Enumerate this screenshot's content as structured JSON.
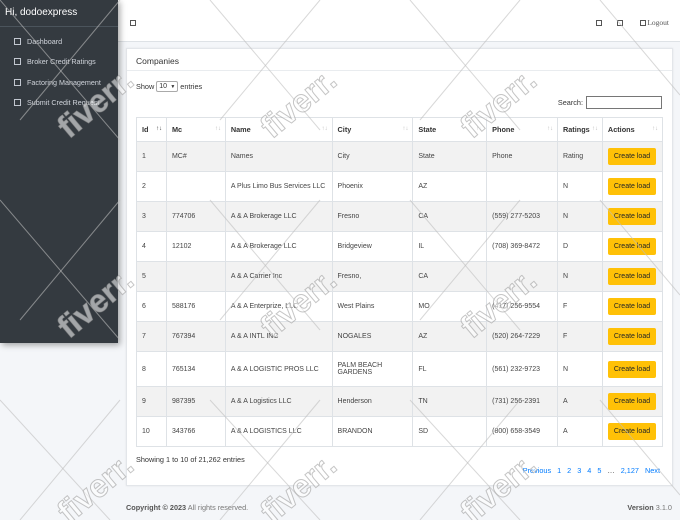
{
  "sidebar": {
    "greeting": "Hi, dodoexpress",
    "items": [
      {
        "label": "Dashboard"
      },
      {
        "label": "Broker Credit Ratings"
      },
      {
        "label": "Factoring Management"
      },
      {
        "label": "Submit Credit Request"
      }
    ]
  },
  "topbar": {
    "logout": "Logout"
  },
  "card": {
    "title": "Companies",
    "show_label": "Show",
    "entries_value": "10",
    "entries_label": "entries",
    "search_label": "Search:"
  },
  "table": {
    "columns": [
      "Id",
      "Mc",
      "Name",
      "City",
      "State",
      "Phone",
      "Ratings",
      "Actions"
    ],
    "rows": [
      {
        "id": "1",
        "mc": "MC#",
        "name": "Names",
        "city": "City",
        "state": "State",
        "phone": "Phone",
        "rating": "Rating",
        "action": "Create load"
      },
      {
        "id": "2",
        "mc": "",
        "name": "A Plus Limo Bus Services LLC",
        "city": "Phoenix",
        "state": "AZ",
        "phone": "",
        "rating": "N",
        "action": "Create load"
      },
      {
        "id": "3",
        "mc": "774706",
        "name": "A & A Brokerage LLC",
        "city": "Fresno",
        "state": "CA",
        "phone": "(559) 277-5203",
        "rating": "N",
        "action": "Create load"
      },
      {
        "id": "4",
        "mc": "12102",
        "name": "A & A Brokerage LLC",
        "city": "Bridgeview",
        "state": "IL",
        "phone": "(708) 369-8472",
        "rating": "D",
        "action": "Create load"
      },
      {
        "id": "5",
        "mc": "",
        "name": "A & A Carrier Inc",
        "city": "Fresno,",
        "state": "CA",
        "phone": "",
        "rating": "N",
        "action": "Create load"
      },
      {
        "id": "6",
        "mc": "588176",
        "name": "A & A Enterprize, LLC",
        "city": "West Plains",
        "state": "MO",
        "phone": "(417) 256-9554",
        "rating": "F",
        "action": "Create load"
      },
      {
        "id": "7",
        "mc": "767394",
        "name": "A & A INTL INC",
        "city": "NOGALES",
        "state": "AZ",
        "phone": "(520) 264-7229",
        "rating": "F",
        "action": "Create load"
      },
      {
        "id": "8",
        "mc": "765134",
        "name": "A & A LOGISTIC PROS LLC",
        "city": "PALM BEACH GARDENS",
        "state": "FL",
        "phone": "(561) 232-9723",
        "rating": "N",
        "action": "Create load"
      },
      {
        "id": "9",
        "mc": "987395",
        "name": "A & A Logistics LLC",
        "city": "Henderson",
        "state": "TN",
        "phone": "(731) 256-2391",
        "rating": "A",
        "action": "Create load"
      },
      {
        "id": "10",
        "mc": "343766",
        "name": "A & A LOGISTICS LLC",
        "city": "BRANDON",
        "state": "SD",
        "phone": "(800) 658-3549",
        "rating": "A",
        "action": "Create load"
      }
    ]
  },
  "pagination": {
    "info": "Showing 1 to 10 of 21,262 entries",
    "previous": "Previous",
    "pages": [
      "1",
      "2",
      "3",
      "4",
      "5"
    ],
    "ellipsis": "…",
    "last": "2,127",
    "next": "Next"
  },
  "footer": {
    "copyright": "Copyright © 2023",
    "rights": "All rights reserved.",
    "version_label": "Version",
    "version": "3.1.0"
  },
  "watermark": {
    "text": "fiverr."
  },
  "colors": {
    "sidebar_bg": "#343a40",
    "button_bg": "#ffc107",
    "link": "#007bff"
  }
}
